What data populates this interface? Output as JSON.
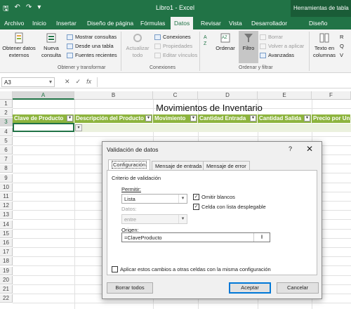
{
  "titlebar": {
    "title": "Libro1  -  Excel",
    "context": "Herramientas de tabla"
  },
  "tabs": [
    "Archivo",
    "Inicio",
    "Insertar",
    "Diseño de página",
    "Fórmulas",
    "Datos",
    "Revisar",
    "Vista",
    "Desarrollador",
    "Diseño"
  ],
  "ribbon": {
    "get_external": "Obtener datos externos",
    "new_query": "Nueva consulta",
    "show_queries": "Mostrar consultas",
    "from_table": "Desde una tabla",
    "recent_sources": "Fuentes recientes",
    "group_get": "Obtener y transformar",
    "refresh_all": "Actualizar todo",
    "connections": "Conexiones",
    "properties": "Propiedades",
    "edit_links": "Editar vínculos",
    "group_conn": "Conexiones",
    "sort": "Ordenar",
    "filter": "Filtro",
    "clear": "Borrar",
    "reapply": "Volver a aplicar",
    "advanced": "Avanzadas",
    "group_sort": "Ordenar y filtrar",
    "text_columns": "Texto en columnas",
    "extra_r": "R",
    "extra_q": "Q",
    "extra_v": "V"
  },
  "formula_bar": {
    "cell_ref": "A3",
    "fx": "fx"
  },
  "columns": [
    "A",
    "B",
    "C",
    "D",
    "E",
    "F"
  ],
  "rows": [
    "1",
    "2",
    "3",
    "4",
    "5",
    "6",
    "7",
    "8",
    "9",
    "10",
    "11",
    "12",
    "13",
    "14",
    "15",
    "16",
    "17",
    "18",
    "19",
    "20",
    "21",
    "22"
  ],
  "sheet": {
    "title": "Movimientos de Inventario",
    "headers": [
      "Clave de Producto",
      "Descripción del Producto",
      "Movimiento",
      "Cantidad Entrada",
      "Cantidad Salida",
      "Precio por Un"
    ]
  },
  "dialog": {
    "title": "Validación de datos",
    "help": "?",
    "close": "✕",
    "tabs": [
      "Configuración",
      "Mensaje de entrada",
      "Mensaje de error"
    ],
    "criteria": "Criterio de validación",
    "allow_label": "Permitir:",
    "allow_value": "Lista",
    "data_label": "Datos:",
    "data_value": "entre",
    "ignore_blank": "Omitir blancos",
    "in_cell_dropdown": "Celda con lista desplegable",
    "source_label": "Origen:",
    "source_value": "=ClaveProducto",
    "apply_all": "Aplicar estos cambios a otras celdas con la misma configuración",
    "clear_all": "Borrar todos",
    "ok": "Aceptar",
    "cancel": "Cancelar"
  },
  "colors": {
    "excel_green": "#217346",
    "header_green": "#8db43e",
    "band": "#ebf1de"
  }
}
